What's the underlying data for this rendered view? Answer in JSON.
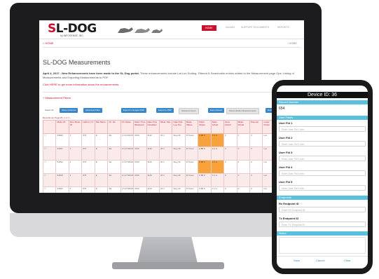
{
  "site": {
    "logo": "SL-DOG",
    "logo_icon": "sl-dog-logo-mark",
    "tagline": "by INFOSENSE, INC.",
    "nav": [
      "HOME",
      "SALMIG",
      "SUPPORT DOCUMENTS",
      "REPORTS"
    ],
    "breadcrumb": "> HOME",
    "breadcrumb_right": "HOME",
    "title": "SL-DOG Measurements",
    "paragraph_bold": "April 4, 2017 - New Enhancements have been made to the SL-Dog portal.",
    "paragraph_rest": "These enhancements include Lat Lon Sorting, Filtered & Searchable entries added to the Measurement page Ops; Listing of Measurements and Exporting Measurements to PDF.",
    "link": "Click HERE to get more information about the enhancements.",
    "filters_label": "+ Measurement Filters",
    "controls": {
      "select_all": "Select All",
      "show_columns": "Show Columns",
      "advanced_filter": "Advanced Filter",
      "export_google": "Export to Google KMZ",
      "export_pdf": "Export to PDF",
      "selected_count": "Selected Count",
      "export_excel": "Export Excel",
      "show_hidden": "Show Hidden Measurements",
      "refresh": "Refresh",
      "search": "Search"
    },
    "pager": "Records per Page 20 ‹ 1 2 3 ›",
    "table": {
      "headers": [
        "",
        "Meas. ID",
        "Dev. Meas. ID",
        "Lat/Lon (Y)",
        "Site Name",
        "Ch. No",
        "Ch. Meas.",
        "Date / Time Measured",
        "Date Time Uploaded",
        "Meas. Site",
        "Gate Tide Lng. Pol",
        "Meas. Status",
        "Flash Status",
        "Span Actual",
        "Sens Actual",
        "Meas. Actual",
        "Pole Lat",
        "Lower Points",
        "Lines",
        "Ad"
      ],
      "rows": [
        [
          "☐",
          "54829",
          "1",
          "876",
          "E",
          "SE",
          "1.0.27/30/2017",
          "2016",
          "SHO",
          "20.1",
          "Sleg 30",
          "R Tower",
          "0.88 ft",
          "0.1 m",
          "0",
          "0",
          "0",
          "Lat"
        ],
        [
          "☐",
          "54831",
          "1",
          "876",
          "E",
          "SE",
          "1.0.27/30/2017",
          "2016",
          "SHO",
          "20.1",
          "Sleg 30",
          "R Tower",
          "0.88 ft",
          "0.1 m",
          "0",
          "0",
          "0",
          "Lat"
        ],
        [
          "☐",
          "54832",
          "1",
          "876",
          "E",
          "SE",
          "1.0.27/30/2017",
          "2016",
          "SHO",
          "20.1",
          "Sleg 30",
          "R Tower",
          "0.88 ft",
          "0.1 m",
          "0",
          "0",
          "0",
          "Lat"
        ],
        [
          "☐",
          "54834",
          "1",
          "876",
          "E",
          "SE",
          "1.0.27/30/2017",
          "2016",
          "SHO",
          "20.1",
          "Sleg 30",
          "R Tower",
          "0.88 ft",
          "0.1 m",
          "0",
          "0",
          "0",
          "Lat"
        ],
        [
          "☐",
          "54836",
          "1",
          "876",
          "E",
          "SE",
          "1.0.27/30/2017",
          "2016",
          "SHO",
          "20.1",
          "Sleg 30",
          "R Tower",
          "0.88 ft",
          "0.1 m",
          "0",
          "0",
          "0",
          "Lat"
        ],
        [
          "☐",
          "54838",
          "1",
          "876",
          "E",
          "SE",
          "1.0.27/30/2017",
          "2016",
          "SHO",
          "20.1",
          "Sleg 30",
          "R Tower",
          "0.88 ft",
          "0.1 m",
          "0",
          "0",
          "0",
          "Lat"
        ]
      ]
    },
    "colors": {
      "brand_red": "#c8102e",
      "row_pink": "#fbeaea",
      "status_orange": "#f7a23b",
      "status_yellow": "#f7e43a"
    }
  },
  "phone": {
    "title": "Device ID: 36",
    "record_label": "Record Number",
    "record_value": "654",
    "user_fields_label": "User Fields",
    "fields": [
      {
        "label": "User Fld 1",
        "placeholder": "Enter User Fld 1 Info"
      },
      {
        "label": "User Fld 2",
        "placeholder": "Enter User Fld 2 Info"
      },
      {
        "label": "User Fld 3",
        "placeholder": "Enter User Fld 3 Info"
      },
      {
        "label": "User Fld 4",
        "placeholder": "Enter User Fld 4 Info"
      },
      {
        "label": "User Fld 5",
        "placeholder": "Enter User Fld 5 Info"
      }
    ],
    "endpoints_label": "Endpoints",
    "rx_label": "Rx Endpoint ID",
    "rx_placeholder": "Enter RX Endpoint ID",
    "tx_label": "Tx Endpoint ID",
    "tx_placeholder": "Enter TX Endpoint ID",
    "notes_label": "Notes",
    "buttons": [
      "Save",
      "Cancel",
      "Clear"
    ],
    "colors": {
      "section_blue": "#5bc0de",
      "title_bar": "#111111"
    }
  }
}
